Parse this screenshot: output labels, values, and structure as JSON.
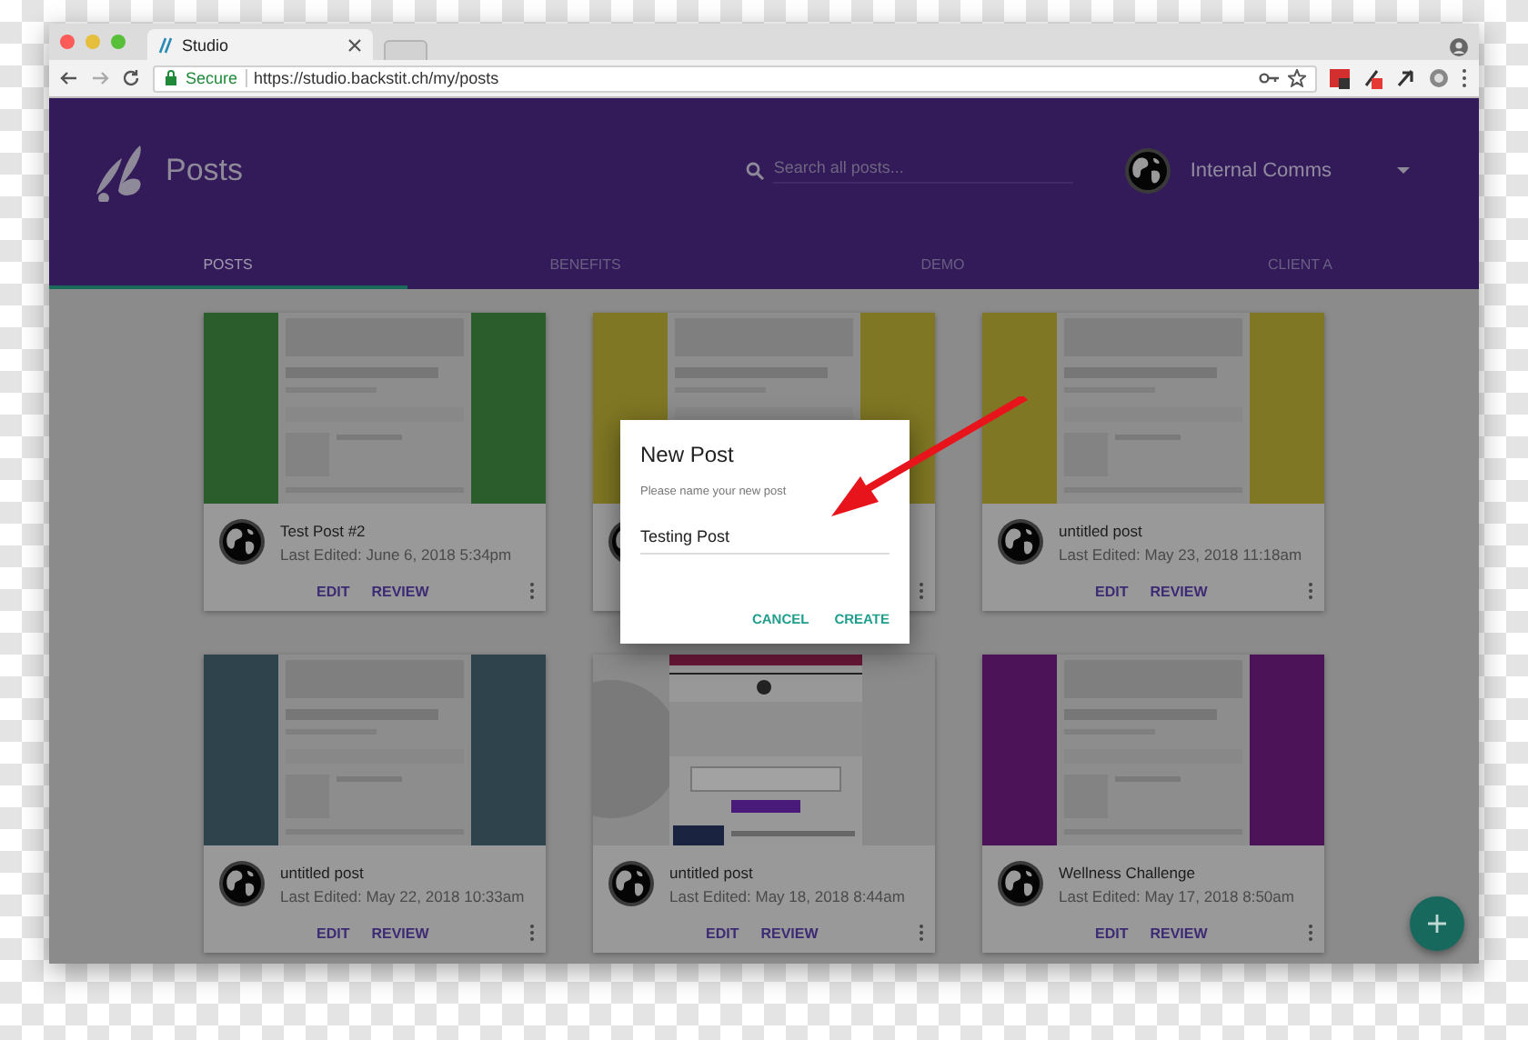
{
  "browser": {
    "tab": {
      "title": "Studio"
    },
    "security": "Secure",
    "url": "https://studio.backstit.ch/my/posts"
  },
  "header": {
    "title": "Posts",
    "search": {
      "placeholder": "Search all posts..."
    },
    "account": {
      "name": "Internal Comms"
    }
  },
  "tabs": [
    {
      "label": "POSTS",
      "selected": true
    },
    {
      "label": "BENEFITS",
      "selected": false
    },
    {
      "label": "DEMO",
      "selected": false
    },
    {
      "label": "CLIENT A",
      "selected": false
    }
  ],
  "posts": [
    {
      "kind": "template",
      "color": "#2b5c2b",
      "title": "Test Post #2",
      "edited": "Last Edited: June 6, 2018 5:34pm",
      "actions": [
        "EDIT",
        "REVIEW"
      ]
    },
    {
      "kind": "template",
      "color": "#7f7723"
    },
    {
      "kind": "template",
      "color": "#7f7723",
      "title": "untitled post",
      "edited": "Last Edited: May 23, 2018 11:18am",
      "actions": [
        "EDIT",
        "REVIEW"
      ]
    },
    {
      "kind": "template",
      "color": "#2f434c",
      "title": "untitled post",
      "edited": "Last Edited: May 22, 2018 10:33am",
      "actions": [
        "EDIT",
        "REVIEW"
      ]
    },
    {
      "kind": "screenshot",
      "color": "#8a8a8a",
      "title": "untitled post",
      "edited": "Last Edited: May 18, 2018 8:44am",
      "actions": [
        "EDIT",
        "REVIEW"
      ]
    },
    {
      "kind": "template",
      "color": "#4c1358",
      "title": "Wellness Challenge",
      "edited": "Last Edited: May 17, 2018 8:50am",
      "actions": [
        "EDIT",
        "REVIEW"
      ]
    }
  ],
  "dialog": {
    "title": "New Post",
    "label": "Please name your new post",
    "value": "Testing Post",
    "buttons": [
      "CANCEL",
      "CREATE"
    ]
  }
}
